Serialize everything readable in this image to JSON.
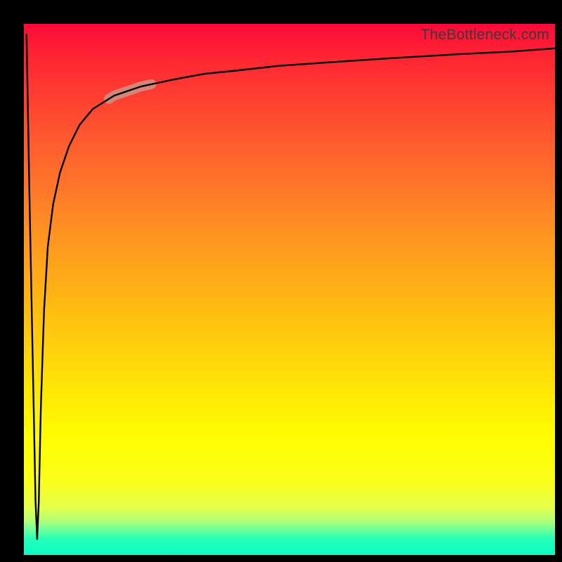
{
  "watermark": "TheBottleneck.com",
  "colors": {
    "frame": "#000000",
    "curve": "#000000",
    "marker": "#cf8f80",
    "gradient_top": "#ff0a39",
    "gradient_bottom": "#0cffc4"
  },
  "chart_data": {
    "type": "line",
    "title": "",
    "xlabel": "",
    "ylabel": "",
    "xlim": [
      0,
      100
    ],
    "ylim": [
      0,
      100
    ],
    "grid": false,
    "legend": false,
    "series": [
      {
        "name": "bottleneck-curve",
        "x": [
          0.5,
          1.0,
          1.6,
          2.2,
          2.5,
          2.8,
          3.2,
          3.8,
          4.5,
          5.5,
          6.8,
          8.5,
          10.5,
          13,
          17,
          22,
          28,
          34,
          40,
          48,
          58,
          70,
          82,
          92,
          100
        ],
        "y": [
          98,
          70,
          40,
          10,
          3,
          10,
          28,
          46,
          58,
          66,
          72,
          77,
          81,
          84,
          86.5,
          88.2,
          89.5,
          90.6,
          91.2,
          92.1,
          92.8,
          93.6,
          94.3,
          94.8,
          95.4
        ]
      }
    ],
    "annotations": [
      {
        "type": "highlight-segment",
        "series": "bottleneck-curve",
        "x_range": [
          16,
          24
        ],
        "description": "highlighted blush-colored band along the curve near the upper-left shoulder"
      }
    ],
    "background_gradient": {
      "direction": "vertical",
      "stops": [
        {
          "pos": 0.0,
          "color": "#ff0a39"
        },
        {
          "pos": 0.42,
          "color": "#ff9a1e"
        },
        {
          "pos": 0.78,
          "color": "#fffd02"
        },
        {
          "pos": 1.0,
          "color": "#0cffc4"
        }
      ]
    }
  }
}
